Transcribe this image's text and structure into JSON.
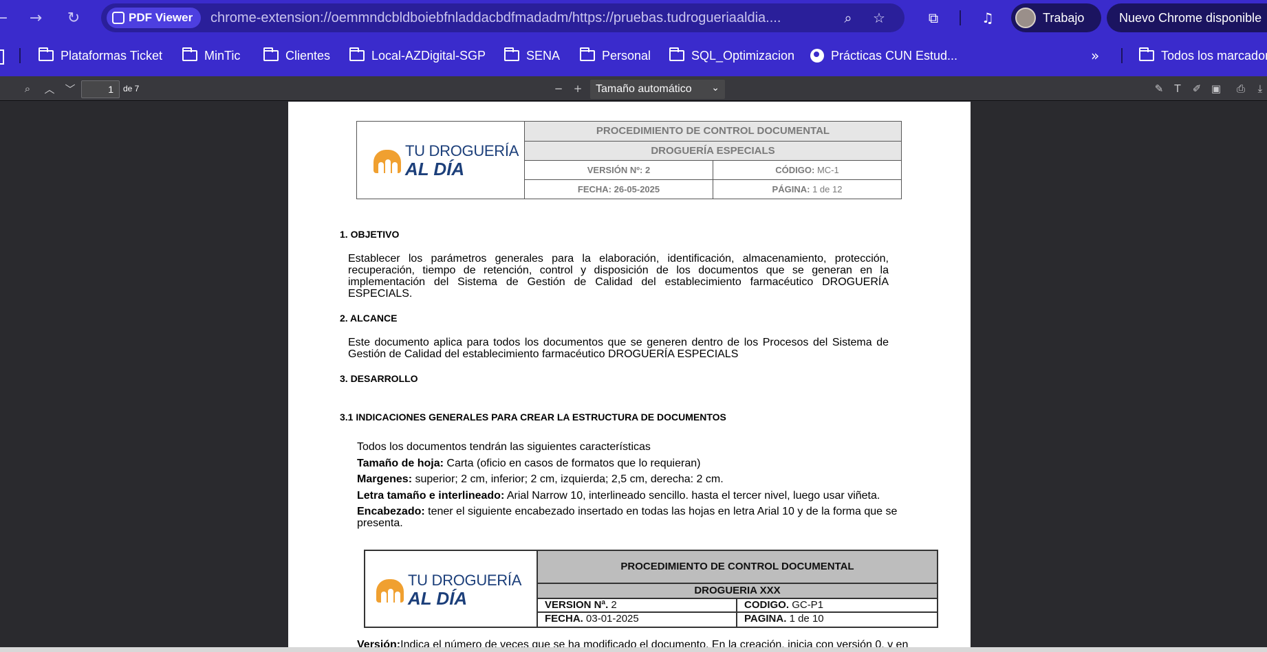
{
  "browser": {
    "chip_label": "PDF Viewer",
    "url": "chrome-extension://oemmndcbldboiebfnladdacbdfmadadm/https://pruebas.tudrogueriaaldia....",
    "profile_name": "Trabajo",
    "update_label": "Nuevo Chrome disponible",
    "accent": "#3a2bcc"
  },
  "bookmarks": [
    {
      "label": "Plataformas Ticket",
      "icon": "folder-icon"
    },
    {
      "label": "MinTic",
      "icon": "folder-icon"
    },
    {
      "label": "Clientes",
      "icon": "folder-icon"
    },
    {
      "label": "Local-AZDigital-SGP",
      "icon": "folder-icon"
    },
    {
      "label": "SENA",
      "icon": "folder-icon"
    },
    {
      "label": "Personal",
      "icon": "folder-icon"
    },
    {
      "label": "SQL_Optimizacion",
      "icon": "folder-icon"
    },
    {
      "label": "Prácticas CUN Estud...",
      "icon": "globe-icon"
    }
  ],
  "bookmarks_all": "Todos los marcadores",
  "pdf_toolbar": {
    "page_number": "1",
    "page_of": "de 7",
    "zoom_label": "Tamaño automático"
  },
  "document": {
    "header1": {
      "logo_line1": "TU DROGUERÍA",
      "logo_line2": "AL DÍA",
      "title": "PROCEDIMIENTO DE CONTROL DOCUMENTAL",
      "subtitle": "DROGUERÍA ESPECIALS",
      "version_label": "VERSIÓN Nº:",
      "version_value": "2",
      "code_label": "CÓDIGO:",
      "code_value": "MC-1",
      "date_label": "FECHA:",
      "date_value": "26-05-2025",
      "page_label": "PÁGINA:",
      "page_value": "1 de 12"
    },
    "s1_title": "1. OBJETIVO",
    "s1_text": "Establecer los parámetros generales para la elaboración, identificación, almacenamiento, protección, recuperación, tiempo de retención, control y disposición de los documentos que se generan en la implementación del Sistema de Gestión de Calidad del establecimiento farmacéutico DROGUERÍA ESPECIALS.",
    "s2_title": "2. ALCANCE",
    "s2_text": "Este documento aplica para todos los documentos que se generen dentro de los Procesos del Sistema de Gestión de Calidad del establecimiento farmacéutico DROGUERÍA ESPECIALS",
    "s3_title": "3. DESARROLLO",
    "s31_title": "3.1 INDICACIONES GENERALES PARA CREAR LA ESTRUCTURA DE DOCUMENTOS",
    "intro": "Todos los documentos tendrán las siguientes características",
    "items": [
      {
        "label": "Tamaño de hoja:",
        "text": "  Carta (oficio en casos de formatos que lo requieran)"
      },
      {
        "label": "Margenes:",
        "text": " superior; 2 cm, inferior; 2 cm, izquierda; 2,5 cm, derecha: 2 cm."
      },
      {
        "label": "Letra tamaño e interlineado:",
        "text": " Arial Narrow 10, interlineado sencillo. hasta el tercer nivel, luego usar viñeta."
      },
      {
        "label": "Encabezado:",
        "text": " tener el siguiente encabezado insertado en todas las hojas en letra Arial 10 y de la forma que se"
      }
    ],
    "encabezado_cont": "presenta.",
    "header2": {
      "logo_line1": "TU DROGUERÍA",
      "logo_line2": "AL DÍA",
      "title": "PROCEDIMIENTO DE CONTROL DOCUMENTAL",
      "subtitle": "DROGUERIA XXX",
      "version_label": "VERSION Nª.",
      "version_value": "2",
      "code_label": "CODIGO.",
      "code_value": "GC-P1",
      "date_label": "FECHA.",
      "date_value": "03-01-2025",
      "page_label": "PAGINA.",
      "page_value": "1 de 10"
    },
    "version_label": "Versión:",
    "version_text": "Indica el número de veces que se ha modificado el documento. En la creación, inicia con versión 0, y en"
  }
}
